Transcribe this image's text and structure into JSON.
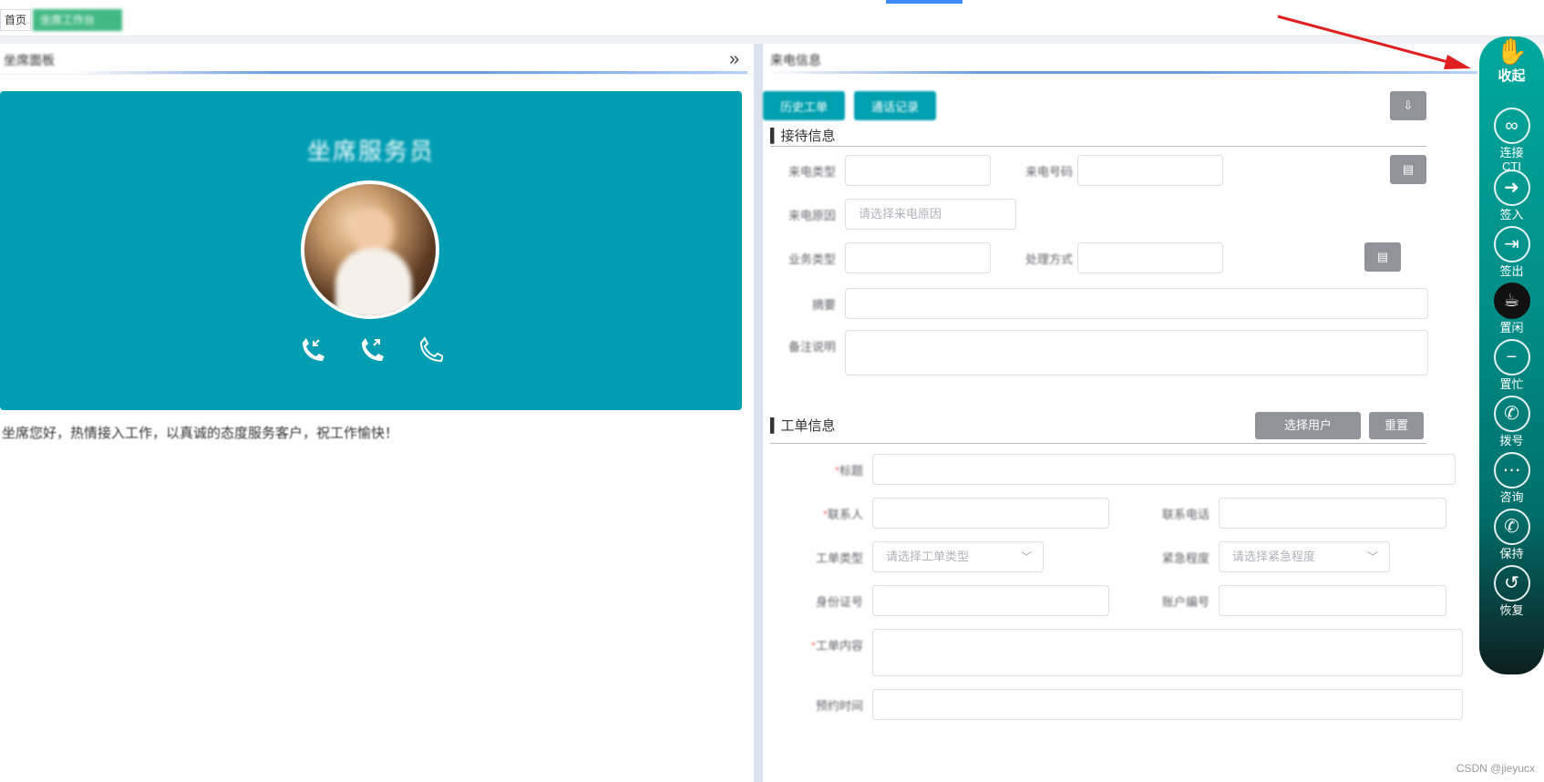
{
  "tabbar": {
    "home_label": "首页",
    "active_tab_label": "坐席工作台"
  },
  "left_panel": {
    "title": "坐席面板",
    "agent_name": "坐席服务员",
    "welcome_text": "坐席您好，热情接入工作，以真诚的态度服务客户，祝工作愉快！",
    "collapse_icon": "double-chevron-right-icon"
  },
  "right_panel": {
    "title": "来电信息",
    "buttons": {
      "btn1": "历史工单",
      "btn2": "通话记录",
      "download": "⇩"
    },
    "reception_section": {
      "title": "接待信息",
      "row1_label1": "来电类型",
      "row1_label2": "来电号码",
      "row2_label": "来电原因",
      "row2_placeholder": "请选择来电原因",
      "row3_label1": "业务类型",
      "row3_label2": "处理方式",
      "row4_label": "摘要",
      "row5_label": "备注说明"
    },
    "ticket_section": {
      "title": "工单信息",
      "btn_user": "选择用户",
      "btn_reset": "重置",
      "title_label": "标题",
      "name_label": "联系人",
      "phone_label": "联系电话",
      "type_label": "工单类型",
      "type_placeholder": "请选择工单类型",
      "urgency_label": "紧急程度",
      "urgency_placeholder": "请选择紧急程度",
      "id_label": "身份证号",
      "account_label": "账户编号",
      "content_label": "工单内容",
      "remark_label": "预约时间"
    }
  },
  "float_bar": {
    "top": {
      "icon": "hand-icon",
      "label": "收起"
    },
    "items": [
      {
        "icon": "link-icon",
        "label": "连接",
        "label2": "CTI"
      },
      {
        "icon": "sign-in-icon",
        "label": "签入"
      },
      {
        "icon": "sign-out-icon",
        "label": "签出"
      },
      {
        "icon": "coffee-icon",
        "label": "置闲"
      },
      {
        "icon": "minus-circle-icon",
        "label": "置忙"
      },
      {
        "icon": "phone-icon",
        "label": "拨号"
      },
      {
        "icon": "chat-icon",
        "label": "咨询"
      },
      {
        "icon": "phone-pause-icon",
        "label": "保持"
      },
      {
        "icon": "history-icon",
        "label": "恢复"
      }
    ]
  },
  "watermark": "CSDN @jieyucx"
}
